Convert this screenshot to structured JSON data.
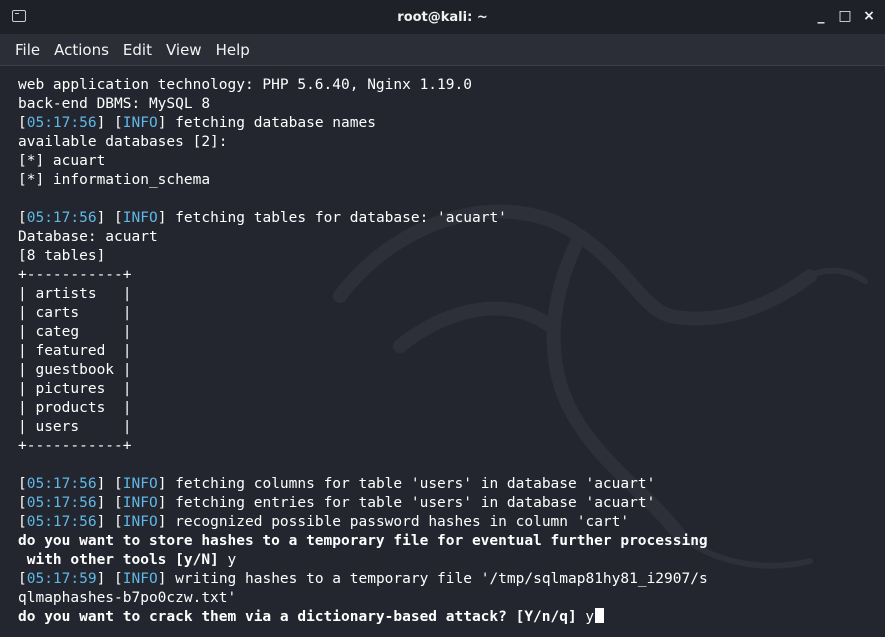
{
  "window": {
    "title": "root@kali: ~",
    "controls": {
      "minimize": "_",
      "maximize": "□",
      "close": "×"
    }
  },
  "menubar": {
    "items": [
      "File",
      "Actions",
      "Edit",
      "View",
      "Help"
    ]
  },
  "terminal": {
    "lines": [
      {
        "type": "plain",
        "text": "web application technology: PHP 5.6.40, Nginx 1.19.0"
      },
      {
        "type": "plain",
        "text": "back-end DBMS: MySQL 8"
      },
      {
        "type": "info",
        "time": "05:17:56",
        "level": "INFO",
        "msg": " fetching database names"
      },
      {
        "type": "plain",
        "text": "available databases [2]:"
      },
      {
        "type": "plain",
        "text": "[*] acuart"
      },
      {
        "type": "plain",
        "text": "[*] information_schema"
      },
      {
        "type": "plain",
        "text": ""
      },
      {
        "type": "info",
        "time": "05:17:56",
        "level": "INFO",
        "msg": " fetching tables for database: 'acuart'"
      },
      {
        "type": "plain",
        "text": "Database: acuart"
      },
      {
        "type": "plain",
        "text": "[8 tables]"
      },
      {
        "type": "plain",
        "text": "+-----------+"
      },
      {
        "type": "plain",
        "text": "| artists   |"
      },
      {
        "type": "plain",
        "text": "| carts     |"
      },
      {
        "type": "plain",
        "text": "| categ     |"
      },
      {
        "type": "plain",
        "text": "| featured  |"
      },
      {
        "type": "plain",
        "text": "| guestbook |"
      },
      {
        "type": "plain",
        "text": "| pictures  |"
      },
      {
        "type": "plain",
        "text": "| products  |"
      },
      {
        "type": "plain",
        "text": "| users     |"
      },
      {
        "type": "plain",
        "text": "+-----------+"
      },
      {
        "type": "plain",
        "text": ""
      },
      {
        "type": "info",
        "time": "05:17:56",
        "level": "INFO",
        "msg": " fetching columns for table 'users' in database 'acuart'"
      },
      {
        "type": "info",
        "time": "05:17:56",
        "level": "INFO",
        "msg": " fetching entries for table 'users' in database 'acuart'"
      },
      {
        "type": "info",
        "time": "05:17:56",
        "level": "INFO",
        "msg": " recognized possible password hashes in column 'cart'"
      },
      {
        "type": "prompt",
        "text": "do you want to store hashes to a temporary file for eventual further processing",
        "answer": ""
      },
      {
        "type": "prompt",
        "text": " with other tools [y/N]",
        "answer": " y"
      },
      {
        "type": "info",
        "time": "05:17:59",
        "level": "INFO",
        "msg": " writing hashes to a temporary file '/tmp/sqlmap81hy81_i2907/s"
      },
      {
        "type": "plain",
        "text": "qlmaphashes-b7po0czw.txt'"
      },
      {
        "type": "prompt-cursor",
        "text": "do you want to crack them via a dictionary-based attack? [Y/n/q]",
        "answer": " y"
      }
    ]
  },
  "colors": {
    "background": "#23262e",
    "titlebar": "#1e2127",
    "menubar": "#2b2e36",
    "text": "#ffffff",
    "info_accent": "#5fb8e8"
  }
}
